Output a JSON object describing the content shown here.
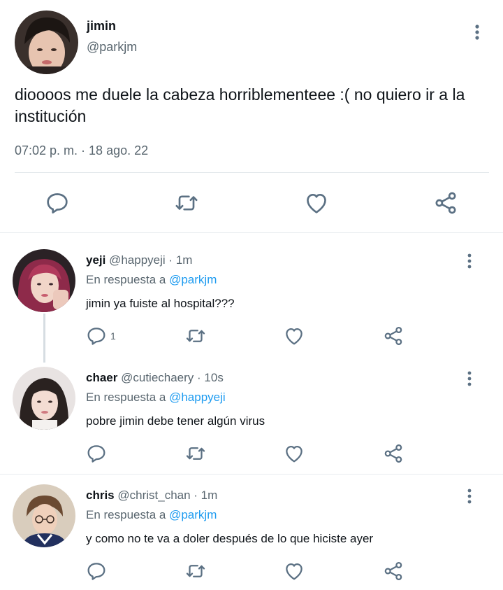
{
  "main_tweet": {
    "name": "jimin",
    "handle": "@parkjm",
    "text": "dioooos me duele la cabeza horriblementeee :( no quiero ir a la institución",
    "timestamp": "07:02 p. m. · 18 ago. 22",
    "actions": [
      "reply-icon",
      "retweet-icon",
      "like-icon",
      "share-icon"
    ]
  },
  "replies": [
    {
      "name": "yeji",
      "meta": "@happyeji · 1m",
      "reply_prefix": "En respuesta a",
      "reply_to": "@parkjm",
      "text": "jimin ya fuiste al hospital???",
      "reply_count": "1"
    },
    {
      "name": "chaer",
      "meta": "@cutiechaery · 10s",
      "reply_prefix": "En respuesta a",
      "reply_to": "@happyeji",
      "text": "pobre jimin debe tener algún virus",
      "reply_count": ""
    },
    {
      "name": "chris",
      "meta": "@christ_chan · 1m",
      "reply_prefix": "En respuesta a",
      "reply_to": "@parkjm",
      "text": "y como no te va a doler después de lo que hiciste ayer",
      "reply_count": ""
    }
  ],
  "colors": {
    "icon": "#5b7083",
    "secondary_text": "#59666f",
    "mention": "#1d9bf0",
    "primary_text": "#0f1419"
  }
}
